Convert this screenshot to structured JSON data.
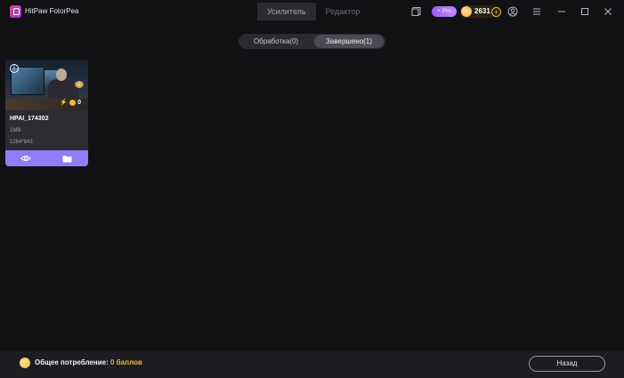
{
  "app": {
    "name": "HitPaw FotorPea"
  },
  "mode_tabs": [
    {
      "label": "Усилитель",
      "active": true
    },
    {
      "label": "Редактор",
      "active": false
    }
  ],
  "header": {
    "pro_label": "+ Pro",
    "coins": "2631"
  },
  "status_tabs": [
    {
      "label": "Обработка(0)",
      "active": false
    },
    {
      "label": "Завершено(1)",
      "active": true
    }
  ],
  "card": {
    "name": "HPAI_174302",
    "size": "1MB",
    "dimensions": "1264*843",
    "cost": "0"
  },
  "footer": {
    "label": "Общее потребление:",
    "value": "0 баллов",
    "back_label": "Назад"
  },
  "colors": {
    "accent": "#8f7cf7",
    "coin": "#f2b53c",
    "background": "#111114"
  }
}
